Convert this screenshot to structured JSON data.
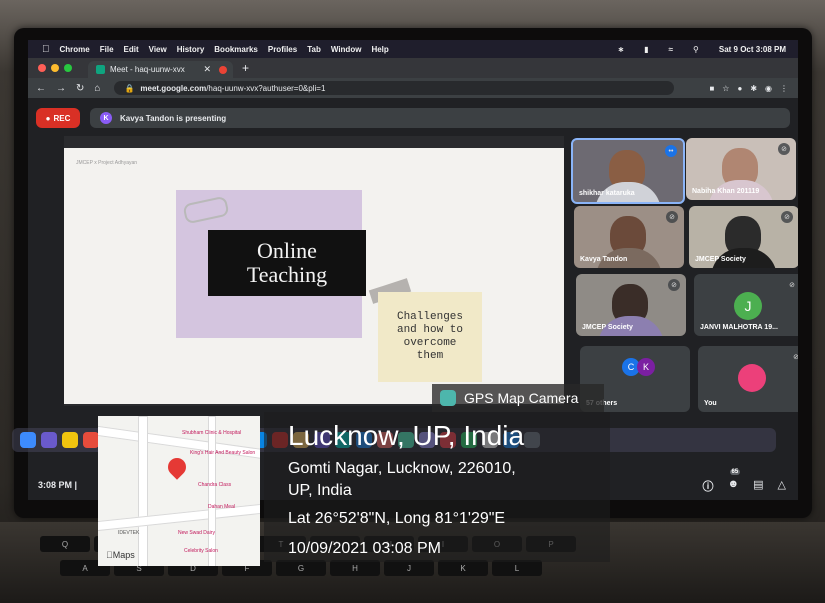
{
  "menubar": {
    "app": "Chrome",
    "items": [
      "File",
      "Edit",
      "View",
      "History",
      "Bookmarks",
      "Profiles",
      "Tab",
      "Window",
      "Help"
    ],
    "datetime": "Sat 9 Oct 3:08 PM"
  },
  "browser": {
    "tab_title": "Meet - haq-uunw-xvx",
    "url_host": "meet.google.com",
    "url_path": "/haq-uunw-xvx?authuser=0&pli=1"
  },
  "meet": {
    "rec_label": "REC",
    "presenter_initial": "K",
    "presenting_text": "Kavya Tandon is presenting",
    "slide": {
      "tag": "JMCEP x Project Adhyayan",
      "title_line1": "Online",
      "title_line2": "Teaching",
      "note_lines": [
        "Challenges",
        "and how to",
        "overcome",
        "them"
      ]
    },
    "participants": [
      {
        "name": "shikhar kataruka"
      },
      {
        "name": "Nabiha Khan 201119"
      },
      {
        "name": "Kavya Tandon"
      },
      {
        "name": "JMCEP Society"
      },
      {
        "name": "JMCEP Society"
      },
      {
        "name": "JANVI MALHOTRA 19...",
        "initial": "J"
      },
      {
        "name": "57 others",
        "initials": [
          "C",
          "K"
        ]
      },
      {
        "name": "You"
      }
    ],
    "bottom_time": "3:08 PM",
    "bottom_separator": "|",
    "people_count": "65"
  },
  "gps": {
    "app_label": "GPS Map Camera",
    "city": "Lucknow, UP, India",
    "address_line1": "Gomti Nagar, Lucknow, 226010,",
    "address_line2": "UP, India",
    "coords": "Lat 26°52'8\"N, Long 81°1'29\"E",
    "timestamp": "10/09/2021 03:08 PM",
    "map": {
      "maps_logo": "Maps",
      "poi": [
        "Shubham Clinic & Hospital",
        "King's Hair And Beauty Salon",
        "Chandra Class",
        "Dahan Meal",
        "New Swad Dairy",
        "Celebrity Salon",
        "IDEVTEK"
      ]
    }
  },
  "keyboard": {
    "keys": [
      "Q",
      "W",
      "E",
      "R",
      "T",
      "Y",
      "U",
      "I",
      "O",
      "P",
      "A",
      "S",
      "D",
      "F",
      "G",
      "H",
      "J",
      "K",
      "L"
    ]
  }
}
